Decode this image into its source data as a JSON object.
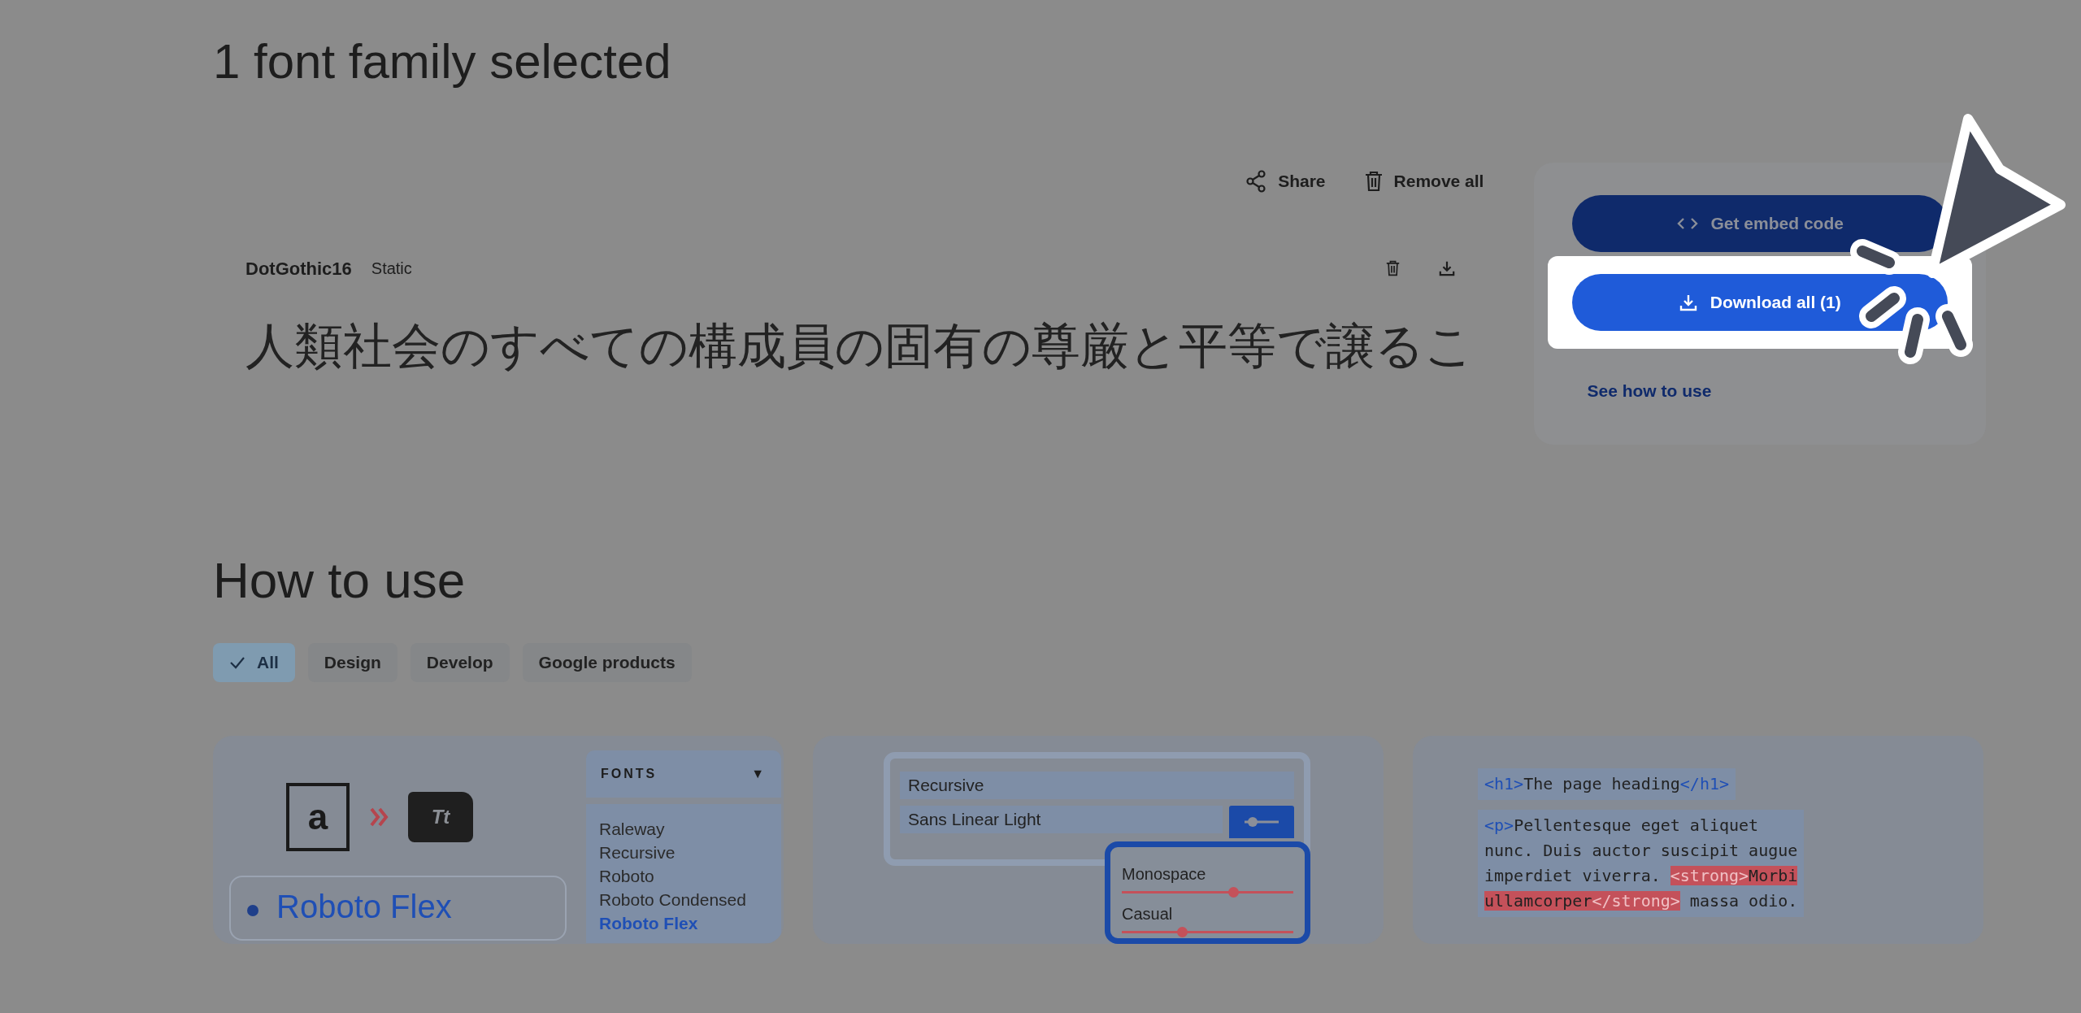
{
  "heading": "1 font family selected",
  "toolbar": [
    {
      "label": "Share"
    },
    {
      "label": "Remove all"
    }
  ],
  "family": {
    "name": "DotGothic16",
    "type": "Static",
    "specimen": "人類社会のすべての構成員の固有の尊厳と平等で譲るこ"
  },
  "side_panel": {
    "buttons": [
      {
        "label": "Get embed code",
        "kind": "secondary",
        "highlighted": false
      },
      {
        "label": "Download all (1)",
        "kind": "primary",
        "highlighted": true
      }
    ],
    "link": "See how to use"
  },
  "how_to_use": {
    "title": "How to use",
    "filters": [
      {
        "label": "All",
        "selected": true
      },
      {
        "label": "Design",
        "selected": false
      },
      {
        "label": "Develop",
        "selected": false
      },
      {
        "label": "Google products",
        "selected": false
      }
    ],
    "cards": [
      {
        "kind": "fonts",
        "doc_glyph": "a",
        "folder_glyph": "Tt",
        "menu_title": "FONTS",
        "menu_caret": "▼",
        "items": [
          {
            "label": "Raleway",
            "selected": false
          },
          {
            "label": "Recursive",
            "selected": false
          },
          {
            "label": "Roboto",
            "selected": false
          },
          {
            "label": "Roboto Condensed",
            "selected": false
          },
          {
            "label": "Roboto Flex",
            "selected": true
          }
        ],
        "preview": "Roboto Flex"
      },
      {
        "kind": "axes",
        "fields": [
          "Recursive",
          "Sans Linear Light"
        ],
        "sliders": [
          {
            "label": "Monospace",
            "level": 0.65
          },
          {
            "label": "Casual",
            "level": 0.35
          }
        ]
      },
      {
        "kind": "code",
        "blocks": [
          [
            [
              {
                "text": "<h1>",
                "kind": "tag"
              },
              {
                "text": "The page heading",
                "kind": "text"
              },
              {
                "text": "</h1>",
                "kind": "tag"
              }
            ]
          ],
          [
            [
              {
                "text": "<p>",
                "kind": "tag"
              },
              {
                "text": "Pellentesque eget aliquet",
                "kind": "text"
              }
            ],
            [
              {
                "text": "nunc. Duis auctor suscipit augue",
                "kind": "text"
              }
            ],
            [
              {
                "text": "imperdiet viverra. ",
                "kind": "text"
              },
              {
                "text": "<strong>",
                "kind": "strong_tag"
              },
              {
                "text": "Morbi",
                "kind": "strong_text"
              }
            ],
            [
              {
                "text": "ullamcorper",
                "kind": "strong_text"
              },
              {
                "text": "</strong>",
                "kind": "strong_tag"
              },
              {
                "text": " massa odio.",
                "kind": "text"
              }
            ]
          ]
        ]
      }
    ]
  }
}
